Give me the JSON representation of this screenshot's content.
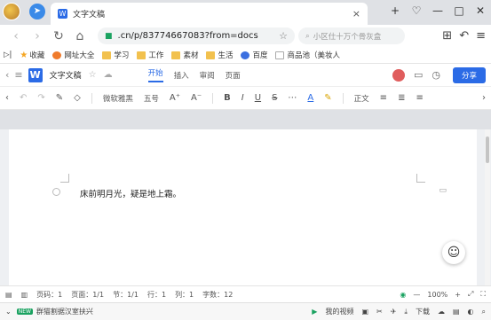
{
  "browser": {
    "tab_title": "文字文稿",
    "tab_close": "×",
    "url": ".cn/p/83774667083?from=docs",
    "search_placeholder": "小区仕十万个骨灰盒",
    "window_controls": [
      "+",
      "♡",
      "—",
      "□",
      "✕"
    ]
  },
  "bookmarks": [
    {
      "label": "收藏",
      "icon": "star-icon"
    },
    {
      "label": "网址大全",
      "icon": "globe-icon"
    },
    {
      "label": "学习",
      "icon": "folder-icon"
    },
    {
      "label": "工作",
      "icon": "folder-icon"
    },
    {
      "label": "素材",
      "icon": "folder-icon"
    },
    {
      "label": "生活",
      "icon": "folder-icon"
    },
    {
      "label": "百度",
      "icon": "baidu-icon"
    },
    {
      "label": "商品池（美妆人",
      "icon": "page-icon"
    }
  ],
  "doc_header": {
    "title": "文字文稿",
    "menus": [
      "开始",
      "插入",
      "审阅",
      "页面"
    ],
    "active_menu": "开始",
    "share_label": "分享"
  },
  "format_toolbar": {
    "font": "微软雅黑",
    "size": "五号",
    "style": "正文"
  },
  "document": {
    "text": "床前明月光，疑是地上霜。"
  },
  "status_bar": {
    "page": "页码：1",
    "pages": "页面：1/1",
    "section": "节：1/1",
    "line": "行：1",
    "column": "列：1",
    "word_count": "字数：12",
    "zoom": "100%"
  },
  "bottom_bar": {
    "badge": "NEW",
    "news": "群猫割据汉室扶兴",
    "video": "我的视频",
    "download": "下载"
  },
  "colors": {
    "accent": "#2b6be6",
    "secure": "#1aa260"
  }
}
